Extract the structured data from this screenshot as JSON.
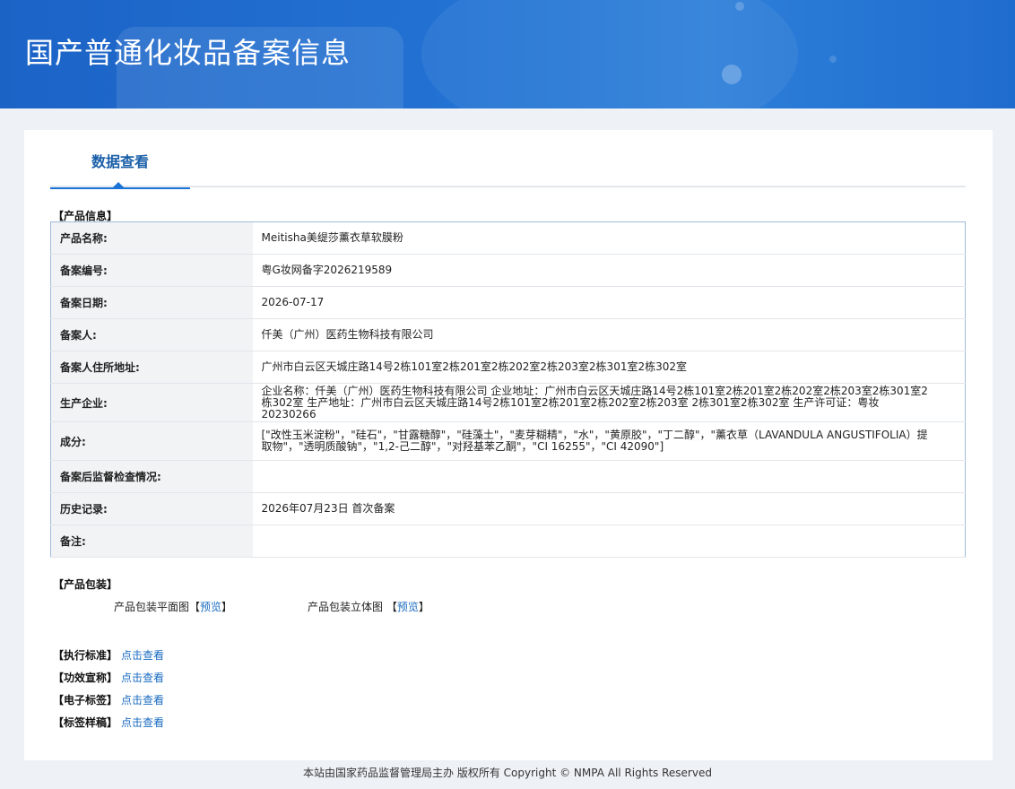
{
  "header": {
    "title": "国产普通化妆品备案信息"
  },
  "tabs": [
    {
      "label": "数据查看"
    }
  ],
  "product_info": {
    "section_title": "【产品信息】",
    "rows": [
      {
        "label": "产品名称:",
        "value": "Meitisha美缇莎薰衣草软膜粉"
      },
      {
        "label": "备案编号:",
        "value": "粤G妆网备字2026219589"
      },
      {
        "label": "备案日期:",
        "value": "2026-07-17"
      },
      {
        "label": "备案人:",
        "value": "仟美（广州）医药生物科技有限公司"
      },
      {
        "label": "备案人住所地址:",
        "value": "广州市白云区天城庄路14号2栋101室2栋201室2栋202室2栋203室2栋301室2栋302室"
      },
      {
        "label": "生产企业:",
        "value": "企业名称：仟美（广州）医药生物科技有限公司 企业地址：广州市白云区天城庄路14号2栋101室2栋201室2栋202室2栋203室2栋301室2栋302室 生产地址：广州市白云区天城庄路14号2栋101室2栋201室2栋202室2栋203室 2栋301室2栋302室 生产许可证：粤妆20230266"
      },
      {
        "label": "成分:",
        "value": "[\"改性玉米淀粉\"，\"硅石\"，\"甘露糖醇\"，\"硅藻土\"，\"麦芽糊精\"，\"水\"，\"黄原胶\"，\"丁二醇\"，\"薰衣草（LAVANDULA ANGUSTIFOLIA）提取物\"，\"透明质酸钠\"，\"1,2-己二醇\"，\"对羟基苯乙酮\"，\"CI 16255\"，\"CI 42090\"]"
      },
      {
        "label": "备案后监督检查情况:",
        "value": ""
      },
      {
        "label": "历史记录:",
        "value": "2026年07月23日 首次备案"
      },
      {
        "label": "备注:",
        "value": ""
      }
    ]
  },
  "packaging": {
    "section_title": "【产品包装】",
    "flat_label": "产品包装平面图",
    "stereo_label": "产品包装立体图",
    "bracket_open": "【",
    "bracket_close": "】",
    "preview_link": "预览"
  },
  "links": [
    {
      "label": "【执行标准】",
      "action": "点击查看"
    },
    {
      "label": "【功效宣称】",
      "action": "点击查看"
    },
    {
      "label": "【电子标签】",
      "action": "点击查看"
    },
    {
      "label": "【标签样稿】",
      "action": "点击查看"
    }
  ],
  "footer": {
    "text": "本站由国家药品监督管理局主办 版权所有 Copyright © NMPA All Rights Reserved"
  }
}
